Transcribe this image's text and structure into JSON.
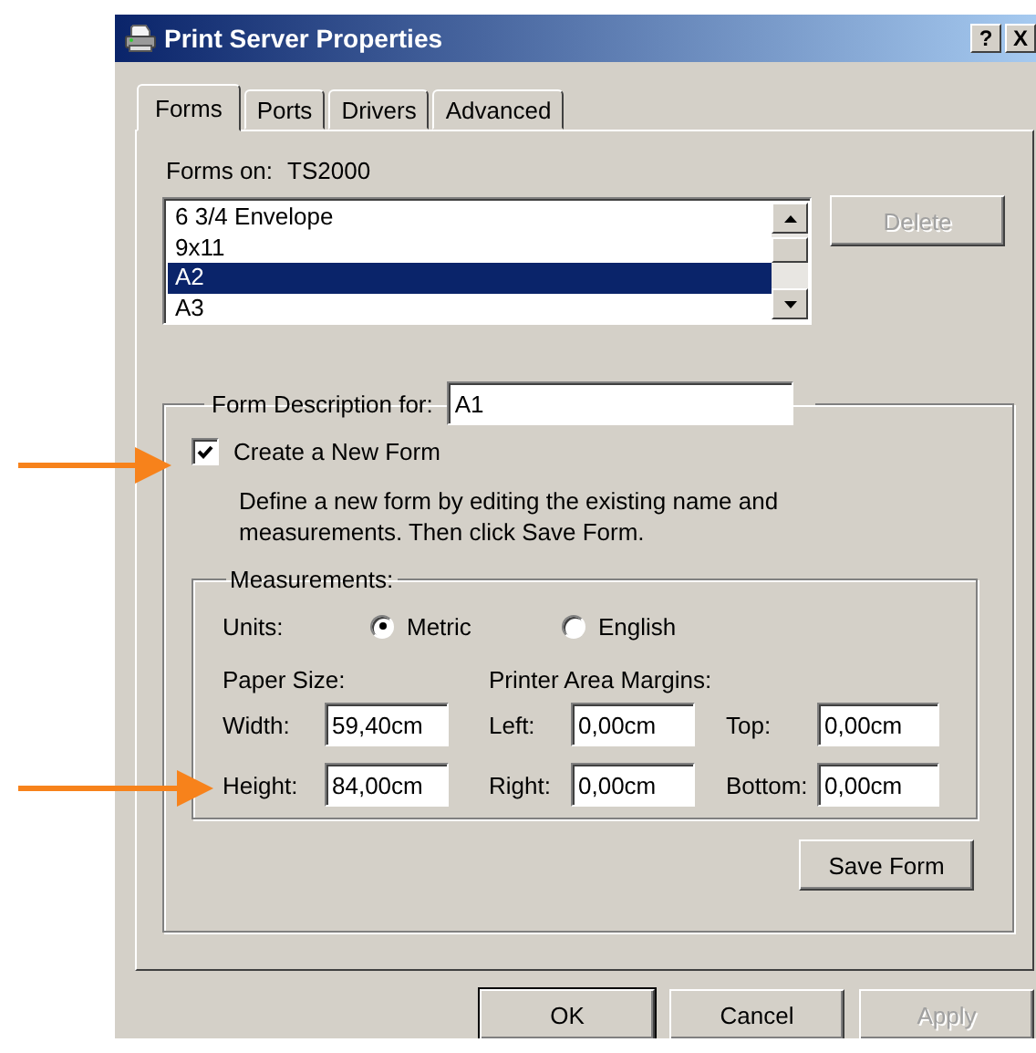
{
  "window": {
    "title": "Print Server Properties",
    "controls": [
      "?",
      "X"
    ]
  },
  "tabs": [
    {
      "label": "Forms",
      "selected": true
    },
    {
      "label": "Ports",
      "selected": false
    },
    {
      "label": "Drivers",
      "selected": false
    },
    {
      "label": "Advanced",
      "selected": false
    }
  ],
  "forms_on": {
    "label": "Forms on:",
    "value": "TS2000"
  },
  "forms_list": [
    {
      "label": "6 3/4 Envelope",
      "selected": false
    },
    {
      "label": "9x11",
      "selected": false
    },
    {
      "label": "A2",
      "selected": true
    },
    {
      "label": "A3",
      "selected": false
    }
  ],
  "delete_button": {
    "label": "Delete",
    "disabled": true
  },
  "form_description": {
    "label": "Form Description for:",
    "value": "A1"
  },
  "create_new_form": {
    "label": "Create a New Form",
    "checked": true
  },
  "instructions": [
    "Define a new form by editing the existing name and",
    "measurements.  Then click Save Form."
  ],
  "measurements": {
    "title": "Measurements:",
    "units_label": "Units:",
    "units": [
      {
        "label": "Metric",
        "selected": true
      },
      {
        "label": "English",
        "selected": false
      }
    ],
    "paper_size_label": "Paper Size:",
    "margins_label": "Printer Area Margins:",
    "rows": [
      {
        "fields": [
          {
            "label": "Width:",
            "value": "59,40cm"
          },
          {
            "label": "Left:",
            "value": "0,00cm"
          },
          {
            "label": "Top:",
            "value": "0,00cm"
          }
        ]
      },
      {
        "fields": [
          {
            "label": "Height:",
            "value": "84,00cm"
          },
          {
            "label": "Right:",
            "value": "0,00cm"
          },
          {
            "label": "Bottom:",
            "value": "0,00cm"
          }
        ]
      }
    ]
  },
  "save_button": {
    "label": "Save Form",
    "disabled": false
  },
  "buttons": [
    {
      "label": "OK",
      "default": true,
      "disabled": false
    },
    {
      "label": "Cancel",
      "default": false,
      "disabled": false
    },
    {
      "label": "Apply",
      "default": false,
      "disabled": true
    }
  ]
}
